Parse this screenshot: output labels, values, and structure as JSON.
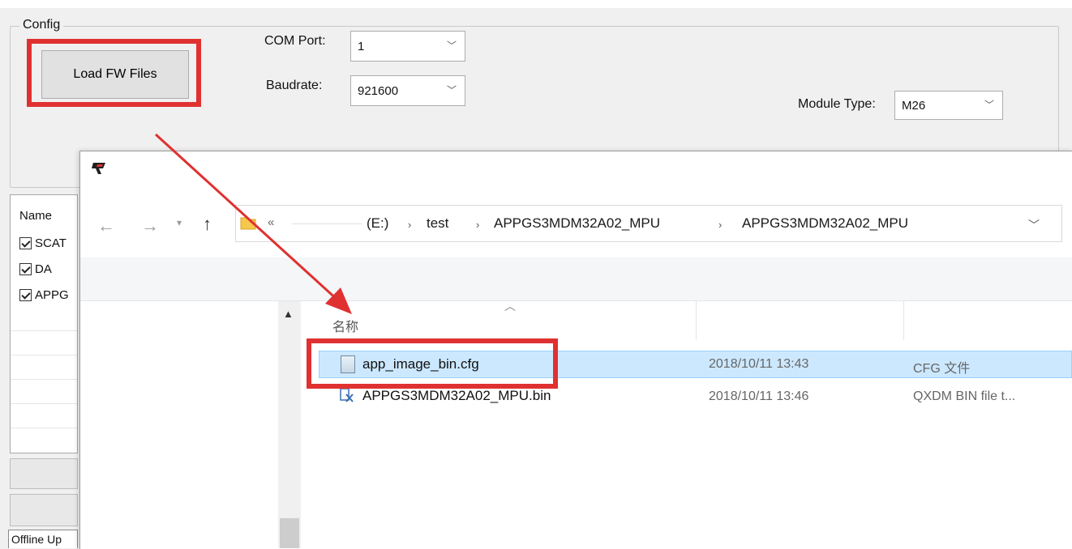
{
  "config": {
    "group_label": "Config",
    "load_button": "Load FW Files",
    "com_port_label": "COM Port:",
    "com_port_value": "1",
    "baudrate_label": "Baudrate:",
    "baudrate_value": "921600",
    "module_type_label": "Module Type:",
    "module_type_value": "M26"
  },
  "file_list": {
    "header": "Name",
    "items": [
      {
        "label": "SCAT",
        "checked": true
      },
      {
        "label": "DA",
        "checked": true
      },
      {
        "label": "APPG",
        "checked": true
      }
    ],
    "offline_tab": "Offline Up"
  },
  "dialog": {
    "breadcrumb_prefix": "«",
    "breadcrumbs": [
      "(E:)",
      "test",
      "APPGS3MDM32A02_MPU",
      "APPGS3MDM32A02_MPU"
    ],
    "breadcrumb_separator": "›",
    "column_name": "名称",
    "files": [
      {
        "name": "app_image_bin.cfg",
        "date": "2018/10/11 13:43",
        "type": "CFG 文件",
        "selected": true,
        "icon": "cfg-file-icon"
      },
      {
        "name": "APPGS3MDM32A02_MPU.bin",
        "date": "2018/10/11 13:46",
        "type": "QXDM BIN file t...",
        "selected": false,
        "icon": "bin-file-icon"
      }
    ]
  },
  "colors": {
    "highlight_red": "#e03131",
    "selection_bg": "#cce8ff",
    "selection_border": "#99d1ff"
  }
}
